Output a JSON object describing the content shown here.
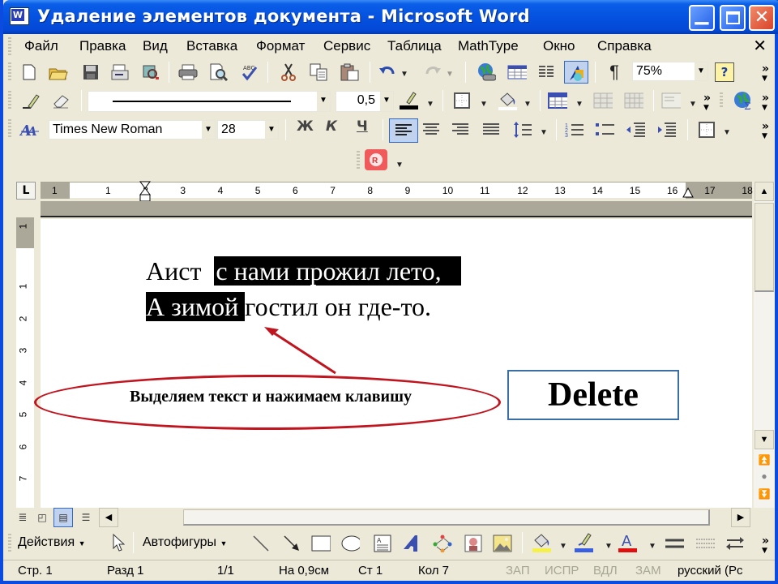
{
  "window": {
    "title": "Удаление элементов документа - Microsoft Word",
    "app_icon": "W",
    "controls": {
      "minimize": "_",
      "maximize": "□",
      "close": "✕"
    }
  },
  "menubar": {
    "items": [
      {
        "label": "Файл"
      },
      {
        "label": "Правка"
      },
      {
        "label": "Вид"
      },
      {
        "label": "Вставка"
      },
      {
        "label": "Формат"
      },
      {
        "label": "Сервис"
      },
      {
        "label": "Таблица"
      },
      {
        "label": "MathType"
      },
      {
        "label": "Окно"
      },
      {
        "label": "Справка"
      }
    ],
    "close_doc": "✕"
  },
  "standard_toolbar": {
    "icons": [
      "new-document-icon",
      "open-folder-icon",
      "save-icon",
      "permission-icon",
      "search-icon",
      "print-icon",
      "print-preview-icon",
      "spelling-icon",
      "cut-icon",
      "copy-icon",
      "paste-icon",
      "undo-icon",
      "redo-icon",
      "hyperlink-icon",
      "tables-borders-icon",
      "insert-table-icon",
      "columns-icon",
      "drawing-icon",
      "show-formatting-icon",
      "help-icon"
    ],
    "zoom_value": "75%",
    "pilcrow": "¶",
    "help": "?"
  },
  "tables_toolbar": {
    "line_style_value": "────────────────",
    "line_weight_value": "0,5"
  },
  "formatting_toolbar": {
    "font_name": "Times New Roman",
    "font_size": "28",
    "bold": "Ж",
    "italic": "К",
    "underline": "Ч",
    "active_alignment": "align-left"
  },
  "ruler": {
    "tab_selector": "L",
    "h_numbers": [
      "1",
      "1",
      "2",
      "3",
      "4",
      "5",
      "6",
      "7",
      "8",
      "9",
      "10",
      "11",
      "12",
      "13",
      "14",
      "15",
      "16",
      "17",
      "18"
    ],
    "v_numbers": [
      "1",
      "1",
      "2",
      "3",
      "4",
      "5",
      "6",
      "7",
      "8"
    ]
  },
  "document": {
    "line1_plain": "Аист ",
    "line1_selected": "с нами прожил лето,",
    "line2_selected": "А зимой ",
    "line2_plain": "гостил он где-то.",
    "callout_text": "Выделяем текст и нажимаем клавишу",
    "key_label": "Delete",
    "accent_color": "#c0141e"
  },
  "drawing_toolbar": {
    "actions_label": "Действия",
    "autoshapes_label": "Автофигуры"
  },
  "statusbar": {
    "page": "Стр. 1",
    "section": "Разд 1",
    "pages": "1/1",
    "at": "На 0,9см",
    "line": "Ст 1",
    "col": "Кол 7",
    "rec": "ЗАП",
    "trk": "ИСПР",
    "ext": "ВДЛ",
    "ovr": "ЗАМ",
    "language": "русский (Рс"
  }
}
